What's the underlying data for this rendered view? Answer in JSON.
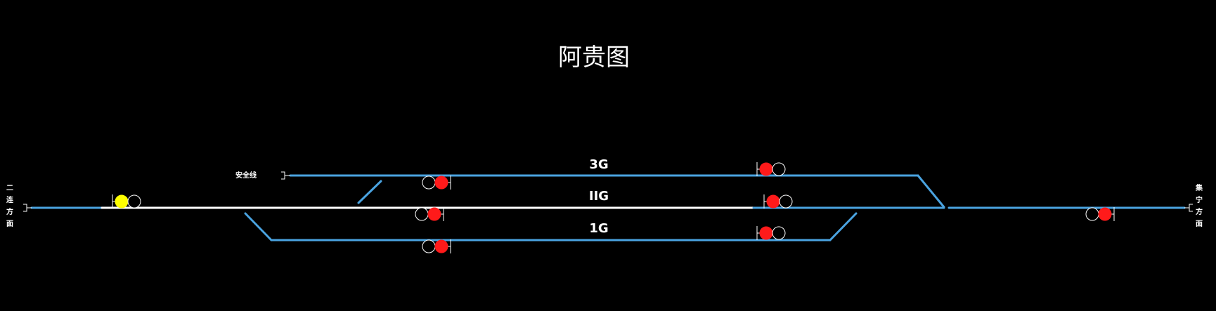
{
  "title": "阿贵图",
  "labels": {
    "track_3": "3G",
    "track_2": "IIG",
    "track_1": "1G",
    "safety_line": "安全线",
    "left_direction": [
      "二",
      "连",
      "方",
      "面"
    ],
    "right_direction": [
      "集",
      "宁",
      "方",
      "面"
    ]
  },
  "colors": {
    "background": "#000000",
    "track": "#4aa3e0",
    "main_route": "#ffffff",
    "signal_red": "#ff1a1a",
    "signal_yellow": "#ffff00",
    "signal_off": "#000000",
    "signal_outline": "#ffffff"
  },
  "signals": [
    {
      "id": "west-entry",
      "lamps": [
        "yellow",
        "off"
      ]
    },
    {
      "id": "track3-west",
      "lamps": [
        "off",
        "red"
      ]
    },
    {
      "id": "track2-west",
      "lamps": [
        "off",
        "red"
      ]
    },
    {
      "id": "track1-west",
      "lamps": [
        "off",
        "red"
      ]
    },
    {
      "id": "track3-east",
      "lamps": [
        "red",
        "off"
      ]
    },
    {
      "id": "track2-east",
      "lamps": [
        "red",
        "off"
      ]
    },
    {
      "id": "track1-east",
      "lamps": [
        "red",
        "off"
      ]
    },
    {
      "id": "east-entry",
      "lamps": [
        "off",
        "red"
      ]
    }
  ]
}
